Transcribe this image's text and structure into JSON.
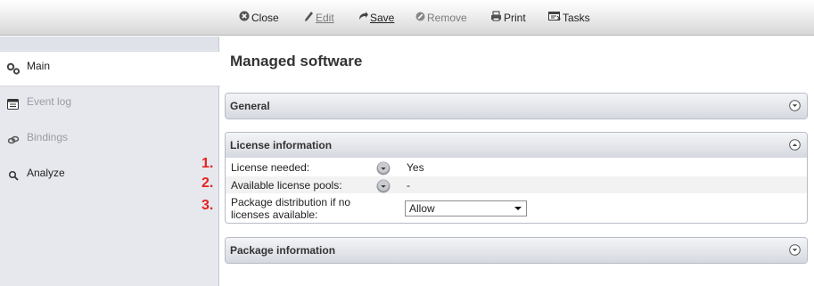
{
  "toolbar": {
    "close": "Close",
    "edit": "Edit",
    "save": "Save",
    "remove": "Remove",
    "print": "Print",
    "tasks": "Tasks"
  },
  "sidebar": {
    "items": [
      {
        "label": "Main",
        "icon": "gears-icon",
        "active": true
      },
      {
        "label": "Event log",
        "icon": "log-icon",
        "enabled": false
      },
      {
        "label": "Bindings",
        "icon": "link-icon",
        "enabled": false
      },
      {
        "label": "Analyze",
        "icon": "magnifier-icon",
        "enabled": true
      }
    ]
  },
  "page": {
    "title": "Managed software"
  },
  "panels": {
    "general": {
      "title": "General",
      "expanded": false
    },
    "license": {
      "title": "License information",
      "expanded": true,
      "rows": [
        {
          "number": "1.",
          "label": "License needed:",
          "value": "Yes"
        },
        {
          "number": "2.",
          "label": "Available license pools:",
          "value": "-"
        },
        {
          "number": "3.",
          "label_line1": "Package distribution if no",
          "label_line2": "licenses available:",
          "value": "Allow"
        }
      ]
    },
    "package": {
      "title": "Package information",
      "expanded": false
    }
  },
  "colors": {
    "annotation_number": "#e3241f",
    "sidebar_bg": "#e6e8ee",
    "panel_header": "#e3e5ea"
  }
}
